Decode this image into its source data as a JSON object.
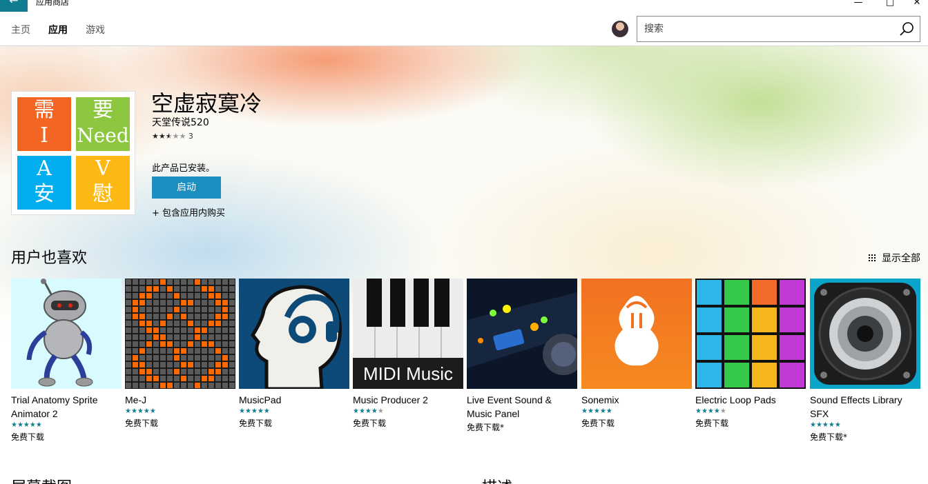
{
  "titlebar": {
    "back_icon": "←",
    "title": "应用商店",
    "minimize": "—",
    "maximize": "□",
    "close": "✕"
  },
  "nav": {
    "tabs": [
      {
        "label": "主页"
      },
      {
        "label": "应用"
      },
      {
        "label": "游戏"
      }
    ],
    "active": "应用"
  },
  "search": {
    "placeholder": "搜索",
    "value": ""
  },
  "app": {
    "name": "空虚寂寞冷",
    "publisher": "天堂传说520",
    "rating_stars": 2.5,
    "rating_count": "3",
    "installed_text": "此产品已安装。",
    "launch_label": "启动",
    "iap_text": "+ 包含应用内购买",
    "logo": [
      {
        "l1": "需",
        "l2": "I",
        "color": "#f26522"
      },
      {
        "l1": "要",
        "l2": "Need",
        "color": "#8dc63f"
      },
      {
        "l1": "A",
        "l2": "安",
        "color": "#00aeef"
      },
      {
        "l1": "V",
        "l2": "慰",
        "color": "#fdb913"
      }
    ]
  },
  "also_like": {
    "title": "用户也喜欢",
    "show_all": "显示全部",
    "items": [
      {
        "title": "Trial Anatomy Sprite Animator 2",
        "stars": 5,
        "price": "免费下载"
      },
      {
        "title": "Me-J",
        "stars": 5,
        "price": "免费下载"
      },
      {
        "title": "MusicPad",
        "stars": 5,
        "price": "免费下载"
      },
      {
        "title": "Music Producer 2",
        "stars": 4,
        "price": "免费下载",
        "thumb_text": "MIDI Music"
      },
      {
        "title": "Live Event Sound & Music Panel",
        "stars": 0,
        "price": "免费下载*"
      },
      {
        "title": "Sonemix",
        "stars": 5,
        "price": "免费下载"
      },
      {
        "title": "Electric Loop Pads",
        "stars": 4,
        "price": "免费下载"
      },
      {
        "title": "Sound Effects Library SFX",
        "stars": 5,
        "price": "免费下载*"
      }
    ]
  },
  "bottom": {
    "screenshots_title": "屏幕截图",
    "description_title": "描述"
  }
}
